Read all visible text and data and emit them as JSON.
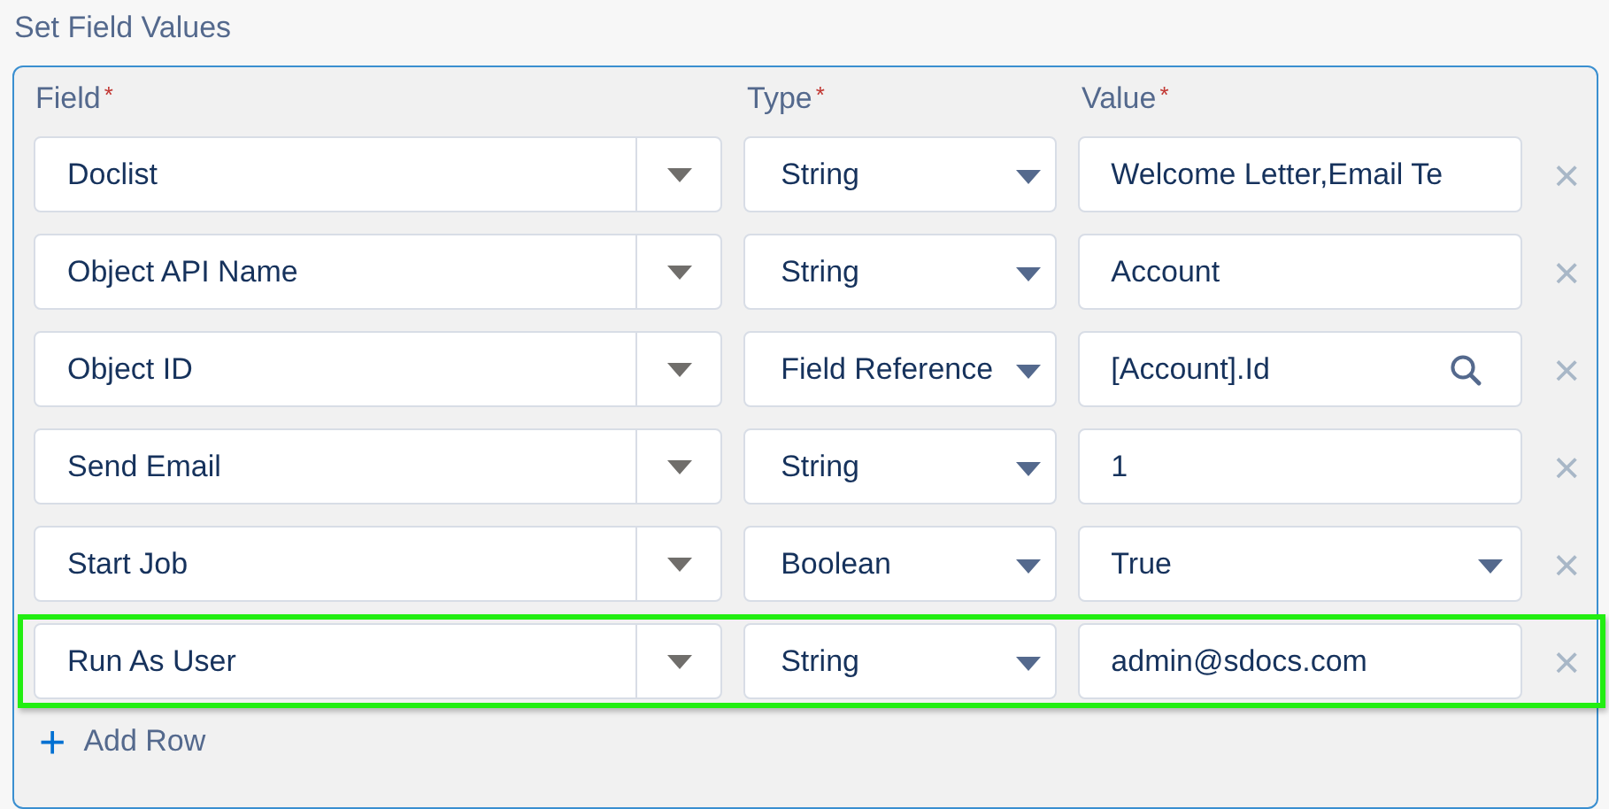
{
  "section_title": "Set Field Values",
  "columns": [
    {
      "label": "Field",
      "required_mark": "*"
    },
    {
      "label": "Type",
      "required_mark": "*"
    },
    {
      "label": "Value",
      "required_mark": "*"
    }
  ],
  "rows": [
    {
      "field": "Doclist",
      "type": "String",
      "value": "Welcome Letter,Email Te",
      "kind": "text",
      "highlighted": false,
      "remove": "×"
    },
    {
      "field": "Object API Name",
      "type": "String",
      "value": "Account",
      "kind": "text",
      "highlighted": false,
      "remove": "×"
    },
    {
      "field": "Object ID",
      "type": "Field Reference",
      "value": "[Account].Id",
      "kind": "lookup",
      "highlighted": false,
      "remove": "×"
    },
    {
      "field": "Send Email",
      "type": "String",
      "value": "1",
      "kind": "text",
      "highlighted": false,
      "remove": "×"
    },
    {
      "field": "Start Job",
      "type": "Boolean",
      "value": "True",
      "kind": "picklist",
      "highlighted": false,
      "remove": "×"
    },
    {
      "field": "Run As User",
      "type": "String",
      "value": "admin@sdocs.com",
      "kind": "text",
      "highlighted": true,
      "remove": "×"
    }
  ],
  "add_row": {
    "label": "Add Row",
    "icon": "+"
  }
}
